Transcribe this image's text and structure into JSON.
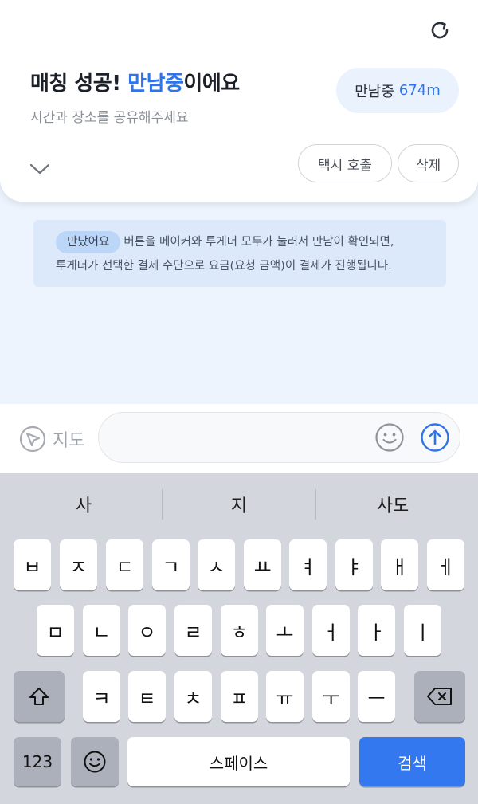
{
  "header": {
    "title_prefix": "매칭 성공! ",
    "title_accent": "만남중",
    "title_suffix": "이에요",
    "subtitle": "시간과 장소를 공유해주세요",
    "distance_label": "만남중",
    "distance_value": "674m",
    "taxi_button": "택시 호출",
    "delete_button": "삭제"
  },
  "notice": {
    "badge": "만났어요",
    "line1": "버튼을 메이커와 투게더 모두가 눌러서 만남이 확인되면,",
    "line2": "투게더가 선택한 결제 수단으로 요금(요청 금액)이 결제가 진행됩니다."
  },
  "input": {
    "map_label": "지도",
    "placeholder": ""
  },
  "keyboard": {
    "suggestions": [
      "사",
      "지",
      "사도"
    ],
    "row1": [
      "ㅂ",
      "ㅈ",
      "ㄷ",
      "ㄱ",
      "ㅅ",
      "ㅛ",
      "ㅕ",
      "ㅑ",
      "ㅐ",
      "ㅔ"
    ],
    "row2": [
      "ㅁ",
      "ㄴ",
      "ㅇ",
      "ㄹ",
      "ㅎ",
      "ㅗ",
      "ㅓ",
      "ㅏ",
      "ㅣ"
    ],
    "row3": [
      "ㅋ",
      "ㅌ",
      "ㅊ",
      "ㅍ",
      "ㅠ",
      "ㅜ",
      "ㅡ"
    ],
    "numbers_key": "123",
    "space_key": "스페이스",
    "search_key": "검색"
  },
  "colors": {
    "accent": "#2f74e8",
    "search_key": "#3478f0",
    "background": "#eef4fd"
  }
}
